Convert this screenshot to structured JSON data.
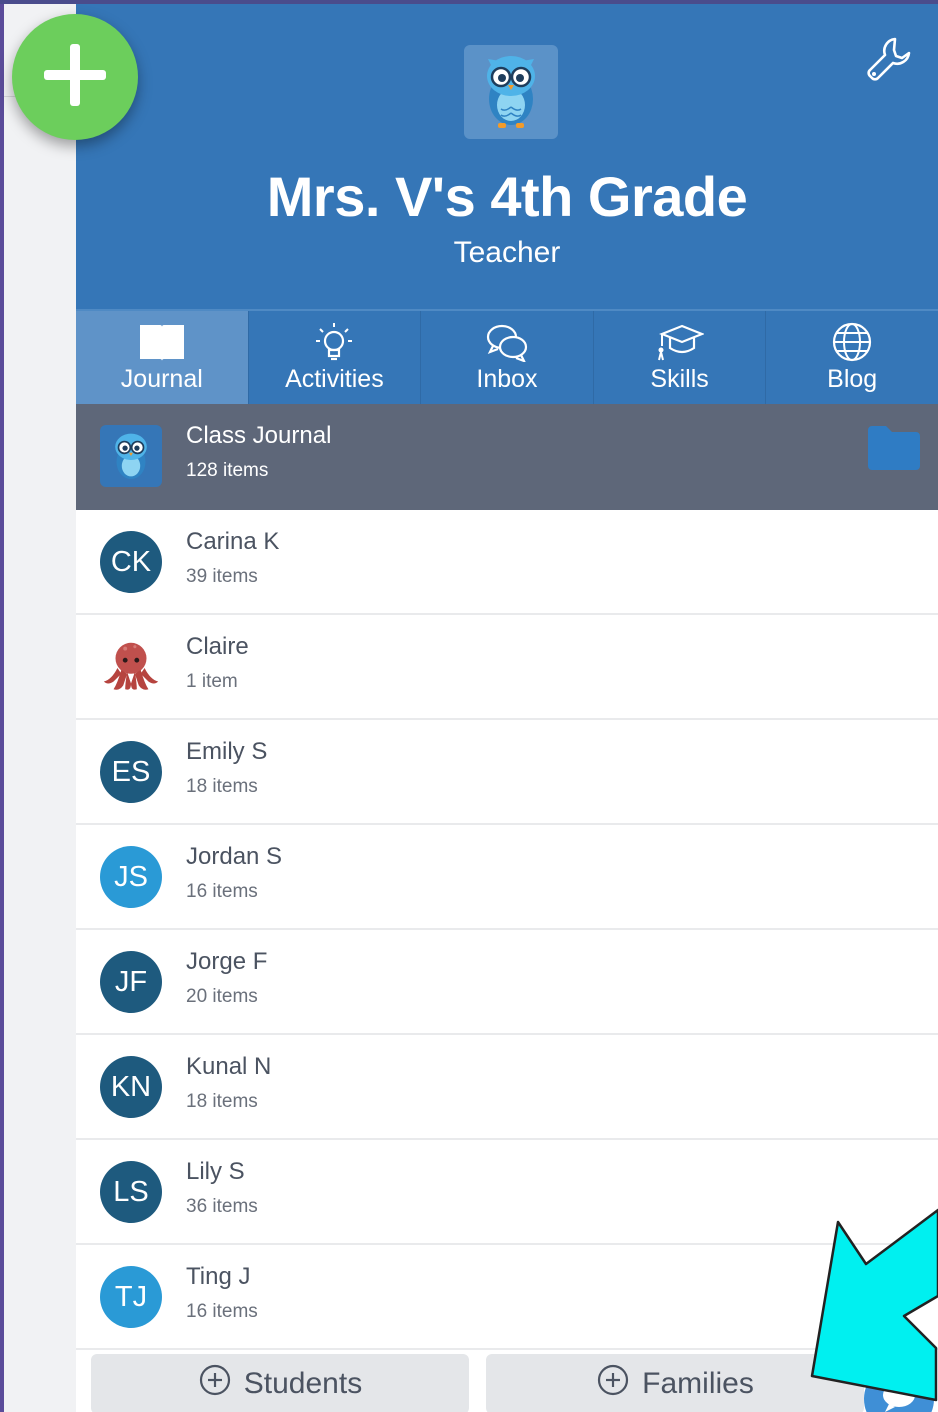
{
  "header": {
    "class_title": "Mrs. V's 4th Grade",
    "role": "Teacher",
    "avatar_icon": "owl-icon",
    "settings_icon": "wrench-icon",
    "background": "#3576b7"
  },
  "fab": {
    "icon": "plus-icon",
    "color": "#6cce5c"
  },
  "tabs": [
    {
      "label": "Journal",
      "icon": "book-icon",
      "active": true
    },
    {
      "label": "Activities",
      "icon": "lightbulb-icon",
      "active": false
    },
    {
      "label": "Inbox",
      "icon": "chat-bubbles-icon",
      "active": false
    },
    {
      "label": "Skills",
      "icon": "graduation-cap-icon",
      "active": false
    },
    {
      "label": "Blog",
      "icon": "globe-icon",
      "active": false
    }
  ],
  "class_journal": {
    "name": "Class Journal",
    "count": "128 items",
    "icon": "owl-icon",
    "folder_icon": "folder-icon"
  },
  "students": [
    {
      "initials": "CK",
      "name": "Carina K",
      "count": "39 items",
      "color": "#1e5a7e"
    },
    {
      "initials": "",
      "name": "Claire",
      "count": "1 item",
      "color": "#c0504d",
      "icon": "octopus-icon"
    },
    {
      "initials": "ES",
      "name": "Emily S",
      "count": "18 items",
      "color": "#1e5a7e"
    },
    {
      "initials": "JS",
      "name": "Jordan S",
      "count": "16 items",
      "color": "#2a9ad6"
    },
    {
      "initials": "JF",
      "name": "Jorge F",
      "count": "20 items",
      "color": "#1e5a7e"
    },
    {
      "initials": "KN",
      "name": "Kunal N",
      "count": "18 items",
      "color": "#1e5a7e"
    },
    {
      "initials": "LS",
      "name": "Lily S",
      "count": "36 items",
      "color": "#1e5a7e"
    },
    {
      "initials": "TJ",
      "name": "Ting J",
      "count": "16 items",
      "color": "#2a9ad6"
    }
  ],
  "bottom_buttons": {
    "students_label": "Students",
    "families_label": "Families",
    "add_icon": "plus-circle-icon"
  },
  "chat_icon": "chat-icon",
  "arrow_color": "#00f0f0"
}
